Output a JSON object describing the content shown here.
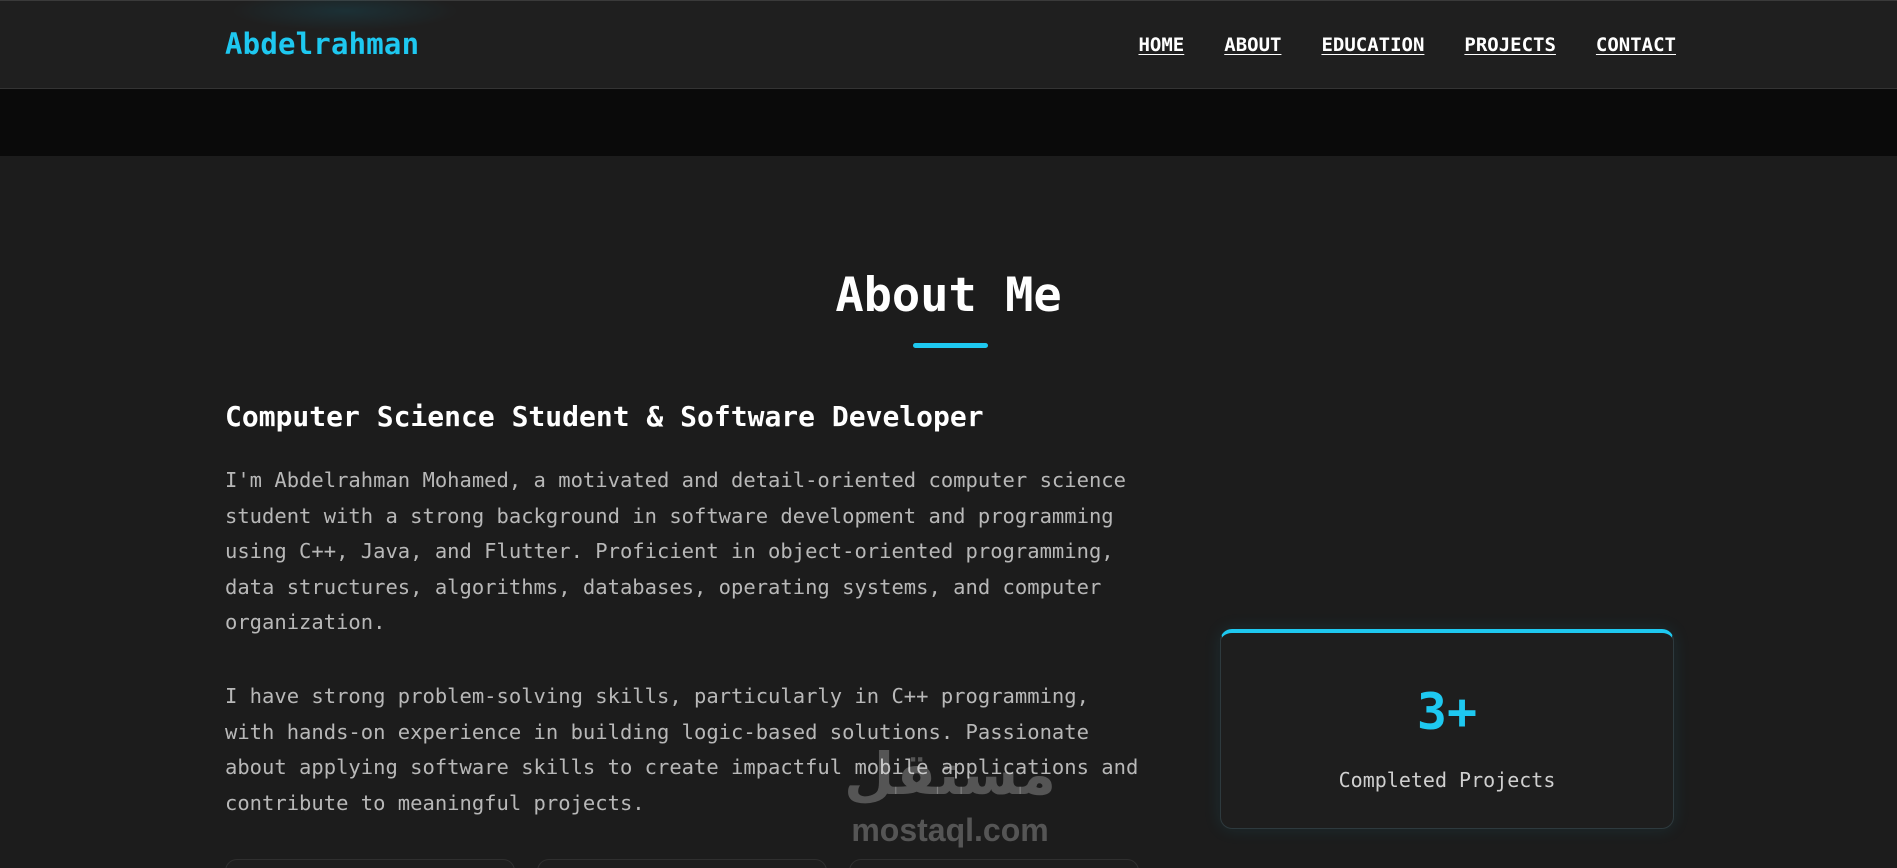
{
  "header": {
    "logo": "Abdelrahman",
    "nav": [
      {
        "label": "HOME"
      },
      {
        "label": "ABOUT"
      },
      {
        "label": "EDUCATION"
      },
      {
        "label": "PROJECTS"
      },
      {
        "label": "CONTACT"
      }
    ]
  },
  "about": {
    "title": "About Me",
    "subtitle": "Computer Science Student & Software Developer",
    "paragraphs": [
      "I'm Abdelrahman Mohamed, a motivated and detail-oriented computer science student with a strong background in software development and programming using C++, Java, and Flutter. Proficient in object-oriented programming, data structures, algorithms, databases, operating systems, and computer organization.",
      "I have strong problem-solving skills, particularly in C++ programming, with hands-on experience in building logic-based solutions. Passionate about applying software skills to create impactful mobile applications and contribute to meaningful projects."
    ],
    "stat": {
      "number": "3+",
      "label": "Completed Projects"
    }
  },
  "watermark": {
    "arabic": "مستقل",
    "latin": "mostaql.com"
  },
  "colors": {
    "accent": "#1ec8f0",
    "background": "#1c1c1c",
    "navbar": "#1f1f1f",
    "band": "#0a0a0a"
  }
}
